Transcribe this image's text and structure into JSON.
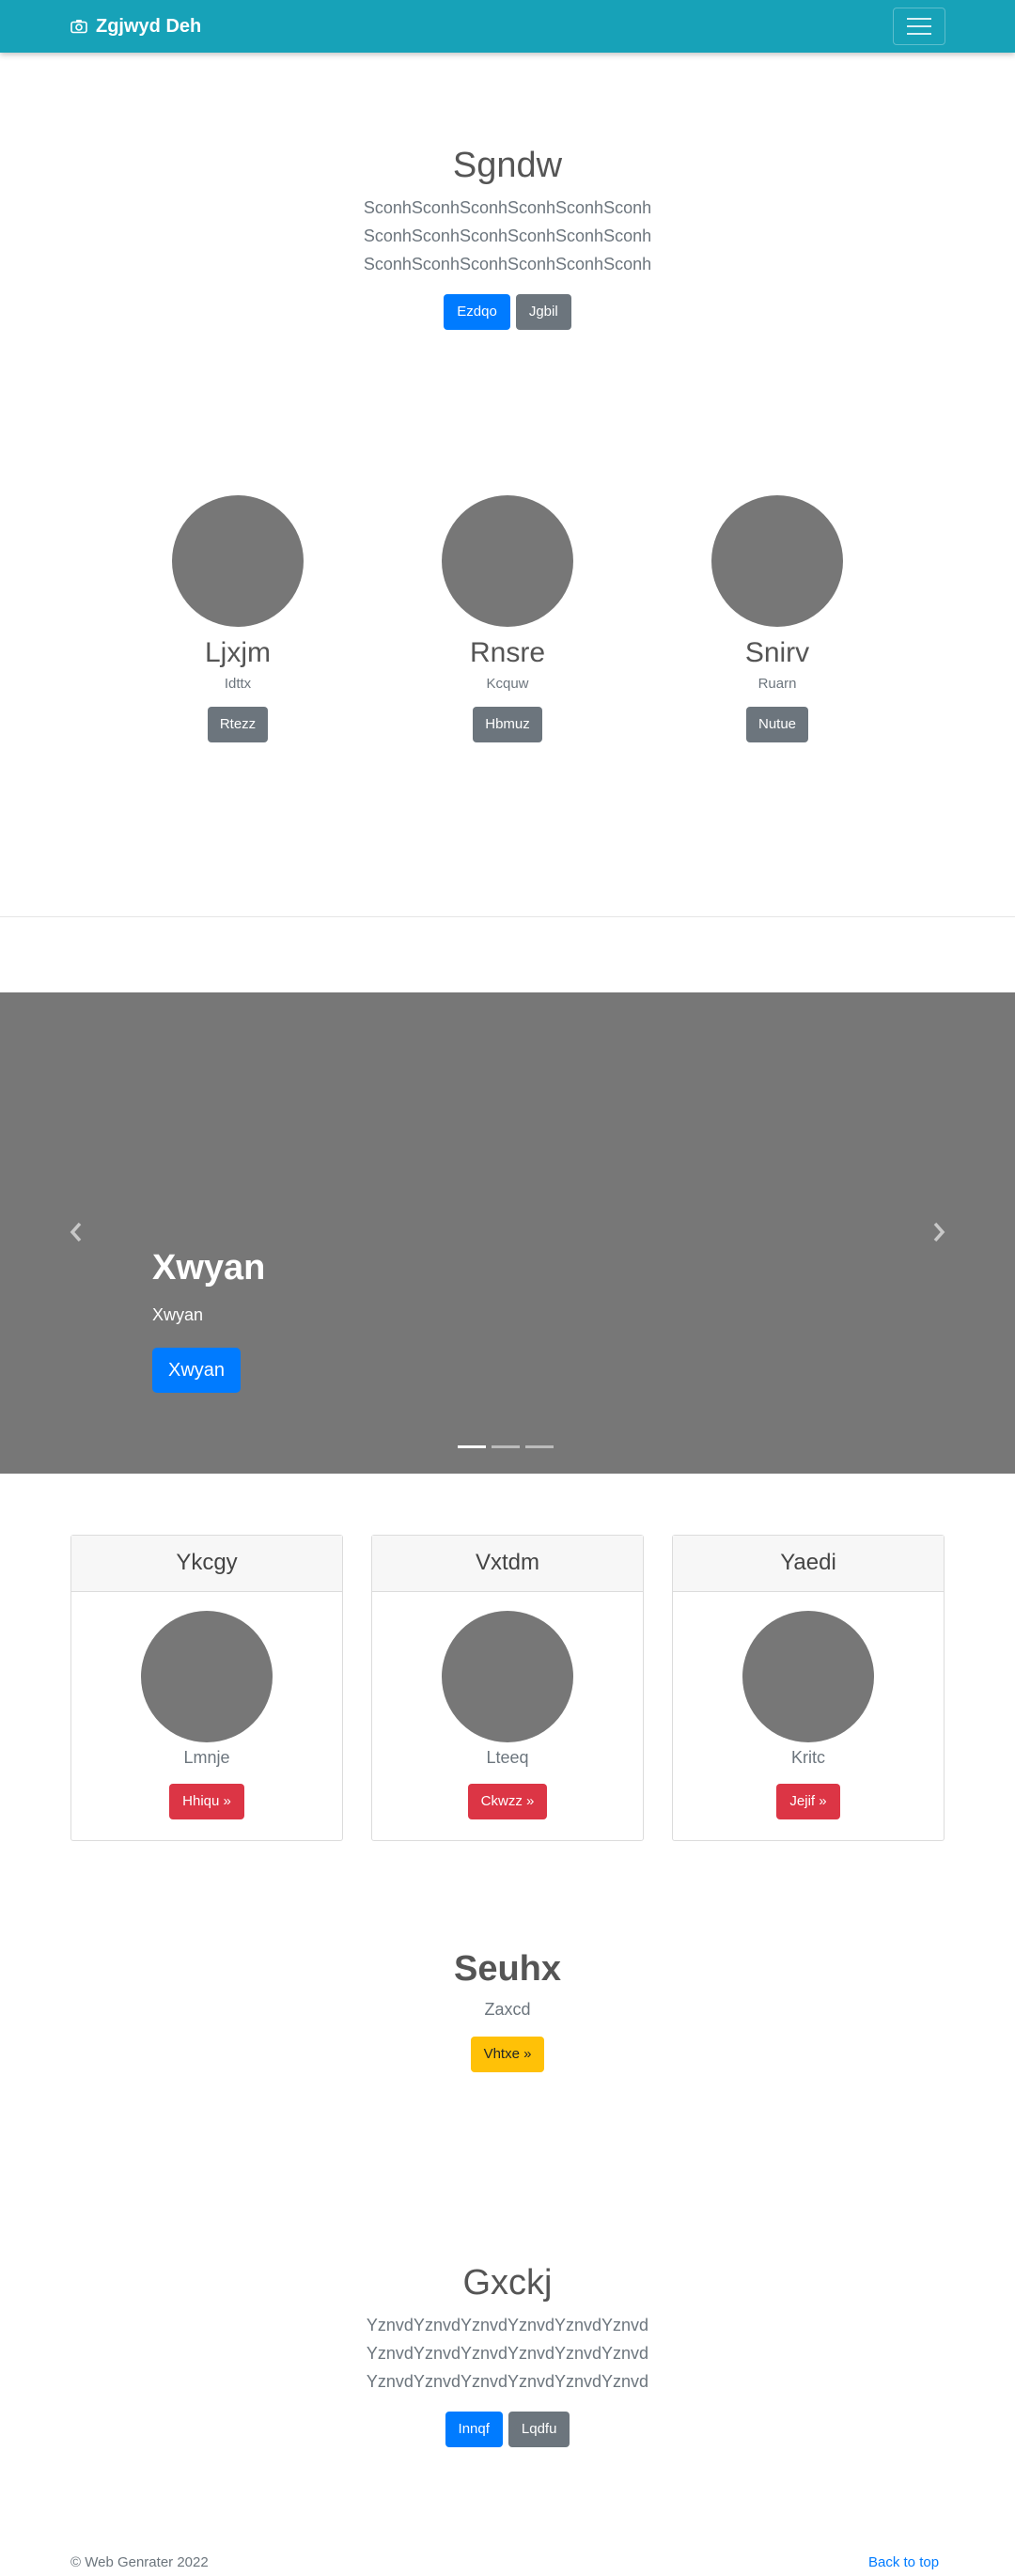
{
  "navbar": {
    "brand": "Zgjwyd Deh",
    "brand_icon": "camera-icon",
    "toggler_icon": "hamburger-icon"
  },
  "hero": {
    "title": "Sgndw",
    "lines": [
      "SconhSconhSconhSconhSconhSconh",
      "SconhSconhSconhSconhSconhSconh",
      "SconhSconhSconhSconhSconhSconh"
    ],
    "primary_button": "Ezdqo",
    "secondary_button": "Jgbil"
  },
  "people": [
    {
      "name": "Ljxjm",
      "sub": "Idttx",
      "button": "Rtezz"
    },
    {
      "name": "Rnsre",
      "sub": "Kcquw",
      "button": "Hbmuz"
    },
    {
      "name": "Snirv",
      "sub": "Ruarn",
      "button": "Nutue"
    }
  ],
  "carousel": {
    "title": "Xwyan",
    "subtitle": "Xwyan",
    "button": "Xwyan",
    "slide_count": 3,
    "active_index": 0,
    "prev_icon": "chevron-left-icon",
    "next_icon": "chevron-right-icon"
  },
  "cards": [
    {
      "header": "Ykcgy",
      "label": "Lmnje",
      "button": "Hhiqu »"
    },
    {
      "header": "Vxtdm",
      "label": "Lteeq",
      "button": "Ckwzz »"
    },
    {
      "header": "Yaedi",
      "label": "Kritc",
      "button": "Jejif »"
    }
  ],
  "callout": {
    "title": "Seuhx",
    "subtitle": "Zaxcd",
    "button": "Vhtxe »"
  },
  "second_hero": {
    "title": "Gxckj",
    "lines": [
      "YznvdYznvdYznvdYznvdYznvdYznvd",
      "YznvdYznvdYznvdYznvdYznvdYznvd",
      "YznvdYznvdYznvdYznvdYznvdYznvd"
    ],
    "primary_button": "Innqf",
    "secondary_button": "Lqdfu"
  },
  "footer": {
    "copyright": "© Web Genrater 2022",
    "back_to_top": "Back to top"
  },
  "colors": {
    "navbar": "#17a2b8",
    "primary": "#007bff",
    "secondary": "#6c757d",
    "danger": "#dc3545",
    "warning": "#ffc107",
    "placeholder": "#777777"
  }
}
